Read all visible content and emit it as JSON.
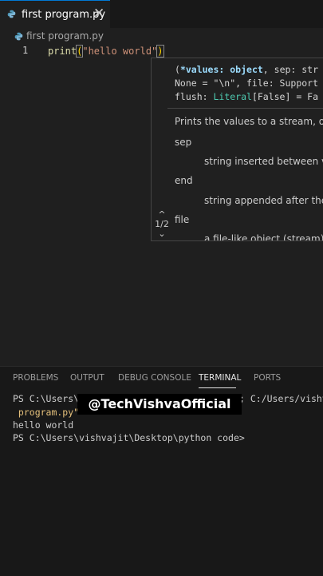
{
  "tab": {
    "label": "first program.py",
    "close_label": "✕",
    "icon": "python-file-icon"
  },
  "breadcrumb": {
    "label": "first program.py",
    "icon": "python-file-icon"
  },
  "editor": {
    "line_number": "1",
    "code": {
      "fn": "print",
      "open": "(",
      "str": "\"hello world\"",
      "close": ")"
    }
  },
  "hover": {
    "sig": {
      "l1a": "(",
      "l1kw": "*values: object",
      "l1b": ", sep: str",
      "l2": "None = \"\\n\", file: Support",
      "l3a": "flush: ",
      "l3ty": "Literal",
      "l3b": "[False] = Fa"
    },
    "description": "Prints the values to a stream, or t",
    "params": [
      {
        "name": "sep",
        "desc": "string inserted between va"
      },
      {
        "name": "end",
        "desc": "string appended after the"
      },
      {
        "name": "file",
        "desc": "a file-like object (stream); d"
      }
    ],
    "nav": {
      "up": "^",
      "counter": "1/2",
      "down": "⌄"
    }
  },
  "panel": {
    "tabs": [
      "PROBLEMS",
      "OUTPUT",
      "DEBUG CONSOLE",
      "TERMINAL",
      "PORTS"
    ],
    "active_tab": "TERMINAL"
  },
  "terminal": {
    "line1_left": "PS C:\\Users\\v",
    "line1_right": "; C:/Users/vishv",
    "line2": " program.py\"",
    "line3": "hello world",
    "line4": "PS C:\\Users\\vishvajit\\Desktop\\python code>"
  },
  "watermark": "@TechVishvaOfficial",
  "colors": {
    "accent": "#0078d4",
    "string": "#ce9178",
    "function": "#dcdcaa",
    "bracket": "#ffd700"
  }
}
